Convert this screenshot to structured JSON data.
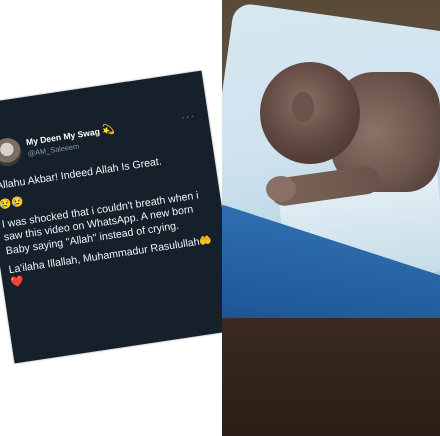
{
  "tweet": {
    "display_name": "My Deen My Swag",
    "name_emoji": "💫",
    "handle": "@AM_Saleeem",
    "more_label": "···",
    "lines": [
      "Allahu Akbar! Indeed Allah Is Great.",
      "😢😢",
      "I was shocked that i couldn't breath when i saw this video on WhatsApp. A new born Baby saying \"Allah\" instead of crying.",
      "La'ilaha Illallah, Muhammadur Rasulullah",
      "🤲",
      "❤️"
    ]
  },
  "photo": {
    "subject": "newborn baby lying on blanket"
  }
}
